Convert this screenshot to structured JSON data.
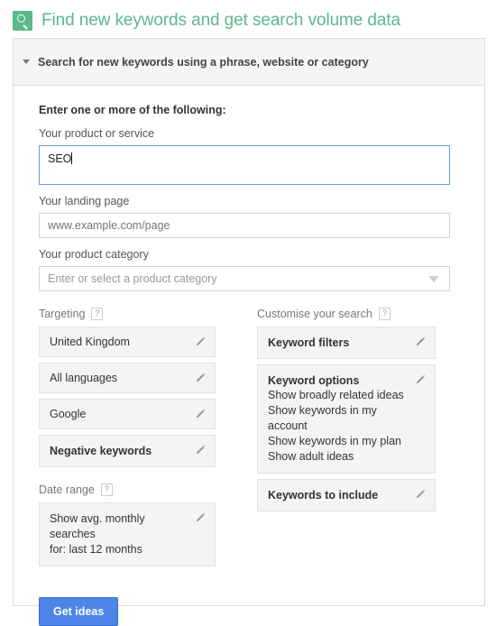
{
  "header": {
    "icon": "search-icon",
    "title": "Find new keywords and get search volume data",
    "title_color": "#5cb98b"
  },
  "panel": {
    "collapse_caret": "caret-down-icon",
    "section_header": "Search for new keywords using a phrase, website or category"
  },
  "form": {
    "heading": "Enter one or more of the following:",
    "product_or_service": {
      "label": "Your product or service",
      "value": "SEO",
      "focused": true
    },
    "landing_page": {
      "label": "Your landing page",
      "placeholder": "www.example.com/page",
      "value": ""
    },
    "product_category": {
      "label": "Your product category",
      "placeholder": "Enter or select a product category",
      "value": ""
    }
  },
  "targeting": {
    "label": "Targeting",
    "help": "?",
    "items": [
      {
        "text": "United Kingdom",
        "bold": false,
        "edit": "pencil-icon"
      },
      {
        "text": "All languages",
        "bold": false,
        "edit": "pencil-icon"
      },
      {
        "text": "Google",
        "bold": false,
        "edit": "pencil-icon"
      },
      {
        "text": "Negative keywords",
        "bold": true,
        "edit": "pencil-icon"
      }
    ]
  },
  "date_range": {
    "label": "Date range",
    "help": "?",
    "line1": "Show avg. monthly searches",
    "line2": "for: last 12 months",
    "edit": "pencil-icon"
  },
  "customise": {
    "label": "Customise your search",
    "help": "?",
    "keyword_filters": {
      "title": "Keyword filters",
      "edit": "pencil-icon"
    },
    "keyword_options": {
      "title": "Keyword options",
      "edit": "pencil-icon",
      "lines": [
        "Show broadly related ideas",
        "Show keywords in my account",
        "Show keywords in my plan",
        "Show adult ideas"
      ]
    },
    "keywords_to_include": {
      "title": "Keywords to include",
      "edit": "pencil-icon"
    }
  },
  "actions": {
    "get_ideas": "Get ideas",
    "button_color": "#4d86e8"
  }
}
